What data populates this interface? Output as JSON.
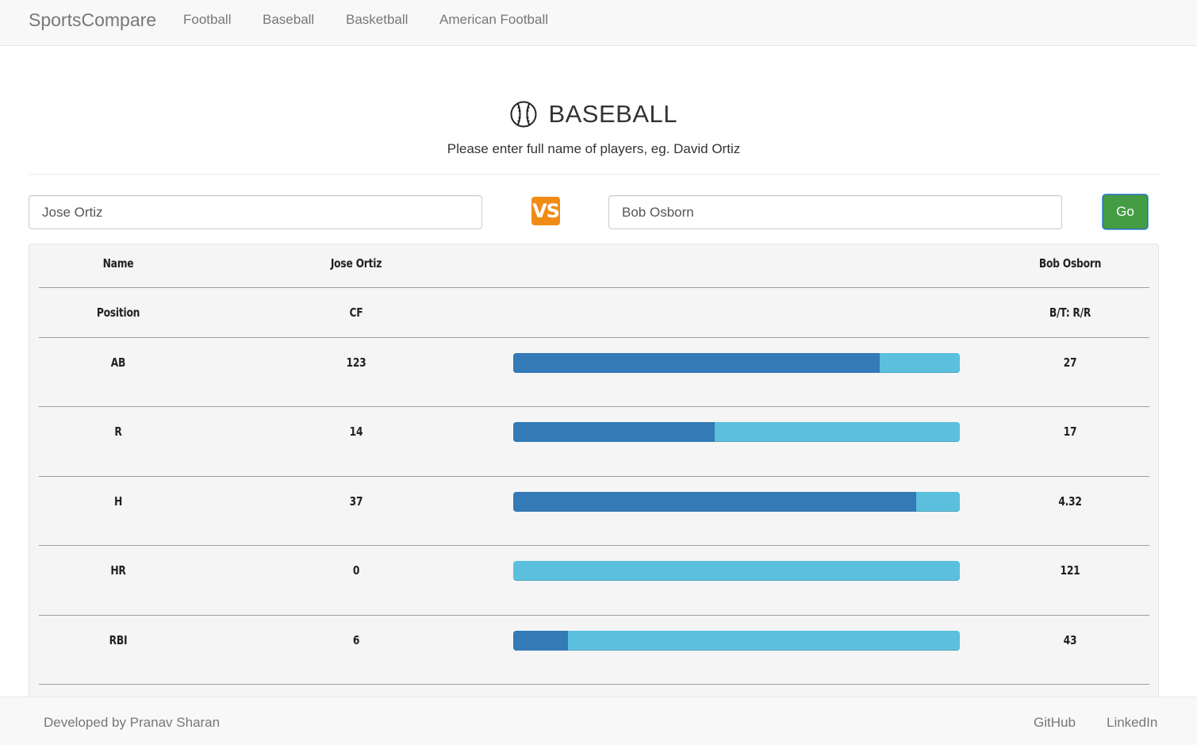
{
  "nav": {
    "brand": "SportsCompare",
    "links": [
      "Football",
      "Baseball",
      "Basketball",
      "American Football"
    ]
  },
  "header": {
    "icon": "baseball-icon",
    "title": "BASEBALL",
    "subtitle": "Please enter full name of players, eg. David Ortiz"
  },
  "search": {
    "player1": "Jose Ortiz",
    "player2": "Bob Osborn",
    "vs_label": "VS",
    "go_label": "Go"
  },
  "table": {
    "rows": [
      {
        "label": "Name",
        "p1": "Jose Ortiz",
        "p2": "Bob Osborn"
      },
      {
        "label": "Position",
        "p1": "CF",
        "p2": "B/T: R/R"
      },
      {
        "label": "AB",
        "p1": "123",
        "p2": "27",
        "share": 0.82
      },
      {
        "label": "R",
        "p1": "14",
        "p2": "17",
        "share": 0.452
      },
      {
        "label": "H",
        "p1": "37",
        "p2": "4.32",
        "share": 0.902
      },
      {
        "label": "HR",
        "p1": "0",
        "p2": "121",
        "share": 0.0
      },
      {
        "label": "RBI",
        "p1": "6",
        "p2": "43",
        "share": 0.123
      }
    ]
  },
  "colors": {
    "player1_bar": "#337ab7",
    "player2_bar": "#5bc0de",
    "go_button": "#449d44",
    "vs_badge": "#f08c16"
  },
  "footer": {
    "credit": "Developed by Pranav Sharan",
    "links": [
      "GitHub",
      "LinkedIn"
    ]
  }
}
